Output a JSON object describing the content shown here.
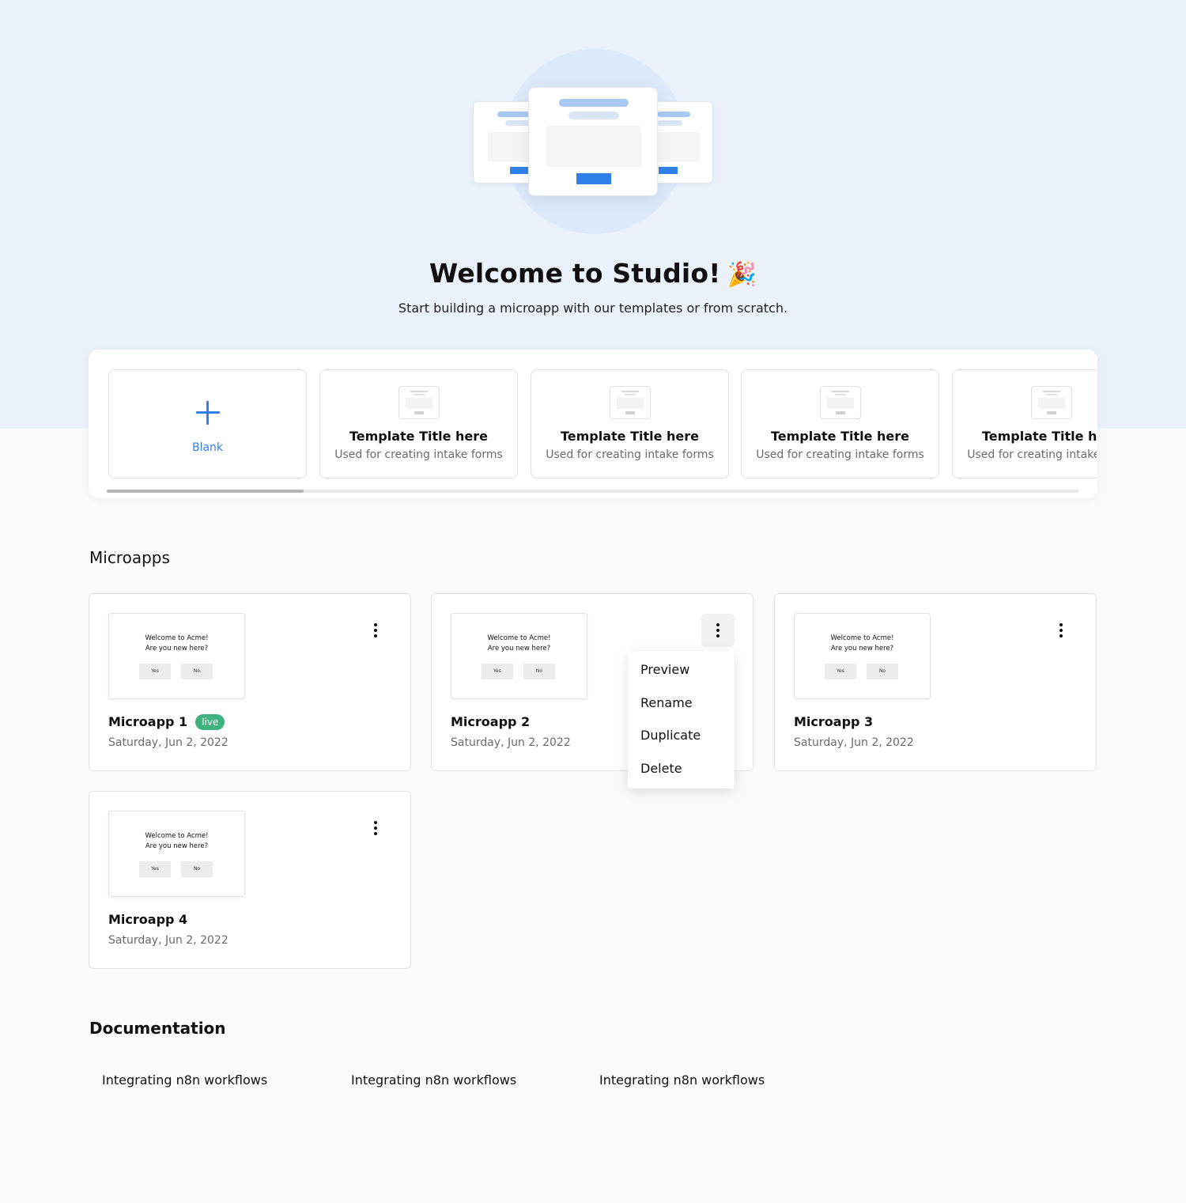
{
  "hero": {
    "title": "Welcome to Studio!",
    "subtitle": "Start building a microapp with our templates or from scratch."
  },
  "templates": {
    "blank_label": "Blank",
    "items": [
      {
        "title": "Template Title here",
        "description": "Used for creating intake forms"
      },
      {
        "title": "Template Title here",
        "description": "Used for creating intake forms"
      },
      {
        "title": "Template Title here",
        "description": "Used for creating intake forms"
      },
      {
        "title": "Template Title here",
        "description": "Used for creating intake forms"
      }
    ]
  },
  "microapps": {
    "section_title": "Microapps",
    "preview": {
      "line1": "Welcome to Acme!",
      "line2": "Are you new here?",
      "yes": "Yes",
      "no": "No"
    },
    "items": [
      {
        "name": "Microapp 1",
        "date": "Saturday, Jun 2, 2022",
        "badge": "live"
      },
      {
        "name": "Microapp 2",
        "date": "Saturday, Jun 2, 2022"
      },
      {
        "name": "Microapp 3",
        "date": "Saturday, Jun 2, 2022"
      },
      {
        "name": "Microapp 4",
        "date": "Saturday, Jun 2, 2022"
      }
    ],
    "menu": [
      "Preview",
      "Rename",
      "Duplicate",
      "Delete"
    ]
  },
  "documentation": {
    "section_title": "Documentation",
    "links": [
      "Integrating n8n workflows",
      "Integrating n8n workflows",
      "Integrating n8n workflows"
    ]
  },
  "colors": {
    "accent": "#2f7fe8",
    "live_badge": "#3fb37f",
    "hero_background": "#ebf1fb"
  },
  "icons": {
    "hero": "party-popper-icon",
    "blank": "plus-icon",
    "card_menu": "kebab-menu-icon"
  }
}
